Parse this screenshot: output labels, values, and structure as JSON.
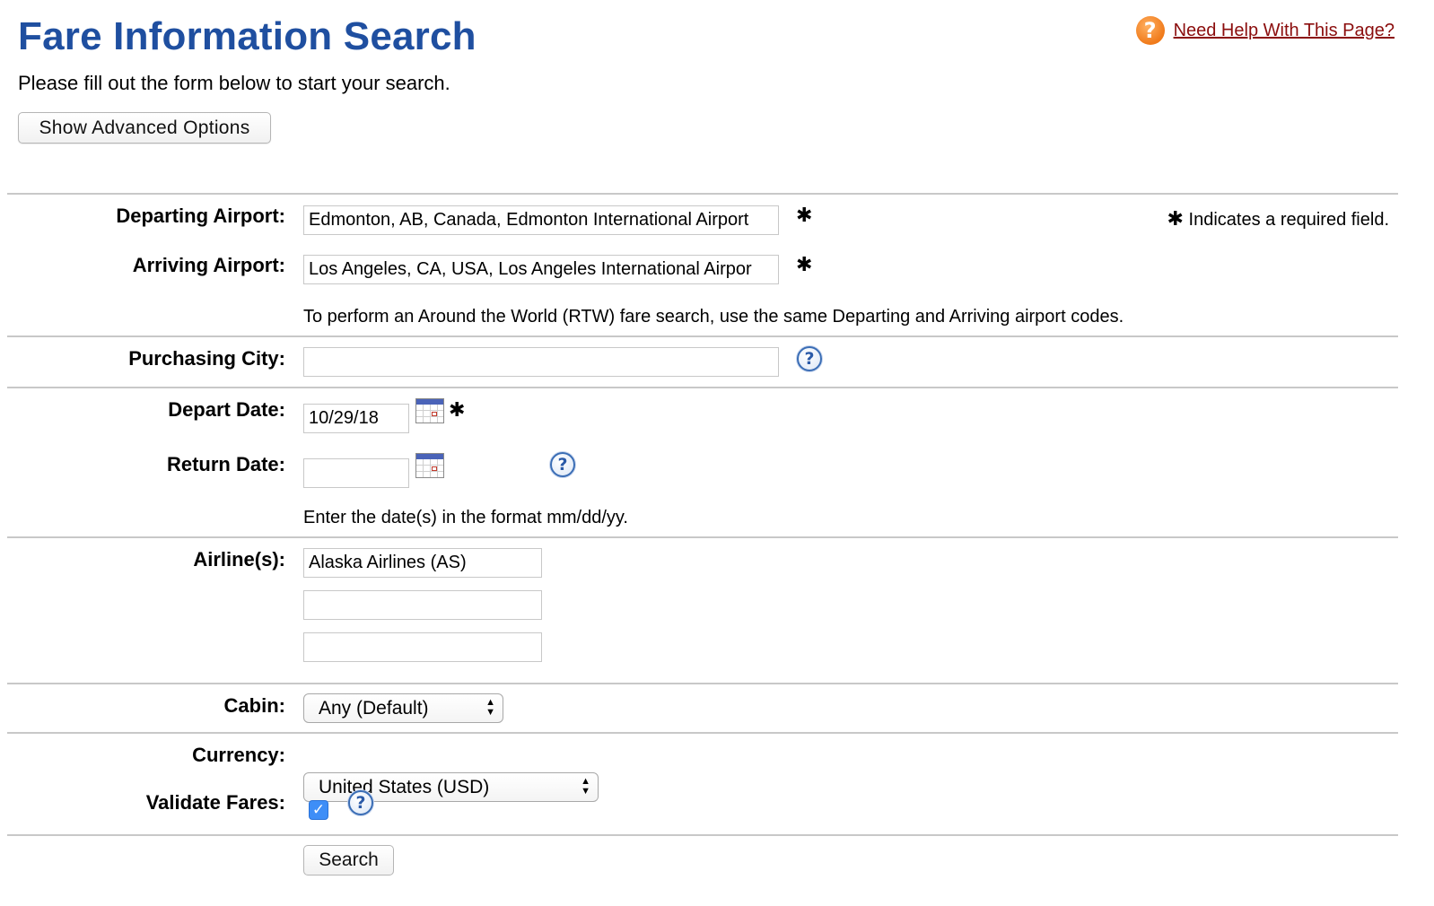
{
  "header": {
    "title": "Fare Information Search",
    "subtitle": "Please fill out the form below to start your search.",
    "advanced_button": "Show Advanced Options",
    "help_link": "Need Help With This Page?",
    "help_icon": "orange-question-icon"
  },
  "required_note": {
    "star": "✱",
    "text": "Indicates a required field."
  },
  "form": {
    "departing": {
      "label": "Departing Airport:",
      "value": "Edmonton, AB, Canada, Edmonton International Airport",
      "required": true
    },
    "arriving": {
      "label": "Arriving Airport:",
      "value": "Los Angeles, CA, USA, Los Angeles International Airpor",
      "required": true
    },
    "rtw_note": "To perform an Around the World (RTW) fare search, use the same Departing and Arriving airport codes.",
    "purchasing_city": {
      "label": "Purchasing City:",
      "value": ""
    },
    "depart_date": {
      "label": "Depart Date:",
      "value": "10/29/18",
      "required": true
    },
    "return_date": {
      "label": "Return Date:",
      "value": ""
    },
    "date_note": "Enter the date(s) in the format mm/dd/yy.",
    "airlines": {
      "label": "Airline(s):",
      "values": [
        "Alaska Airlines (AS)",
        "",
        ""
      ]
    },
    "cabin": {
      "label": "Cabin:",
      "selected": "Any (Default)"
    },
    "currency": {
      "label": "Currency:",
      "selected": "United States (USD)"
    },
    "validate": {
      "label": "Validate Fares:",
      "checked": true,
      "check_glyph": "✓"
    },
    "search_button": "Search"
  },
  "icons": {
    "help_glyph": "?",
    "star_glyph": "✱",
    "select_arrows": "▲▼"
  },
  "colors": {
    "title": "#1f4fa0",
    "help_link": "#8b0d0d",
    "help_icon_orange": "#f07a1a",
    "checkbox": "#3e8ef7",
    "question_icon": "#3a6db5"
  }
}
